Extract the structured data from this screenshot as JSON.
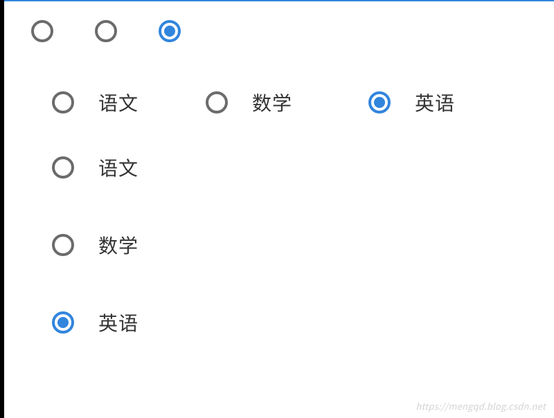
{
  "theme": {
    "accent": "#3285dd",
    "ring_off": "#6b6b6b"
  },
  "row1": {
    "options": [
      {
        "id": "r1a",
        "checked": false
      },
      {
        "id": "r1b",
        "checked": false
      },
      {
        "id": "r1c",
        "checked": true
      }
    ]
  },
  "row2": {
    "options": [
      {
        "id": "h-chinese",
        "label": "语文",
        "checked": false
      },
      {
        "id": "h-math",
        "label": "数学",
        "checked": false
      },
      {
        "id": "h-english",
        "label": "英语",
        "checked": true
      }
    ]
  },
  "vgroup": {
    "options": [
      {
        "id": "v-chinese",
        "label": "语文",
        "checked": false
      },
      {
        "id": "v-math",
        "label": "数学",
        "checked": false
      },
      {
        "id": "v-english",
        "label": "英语",
        "checked": true
      }
    ]
  },
  "watermark": "https://mengqd.blog.csdn.net"
}
